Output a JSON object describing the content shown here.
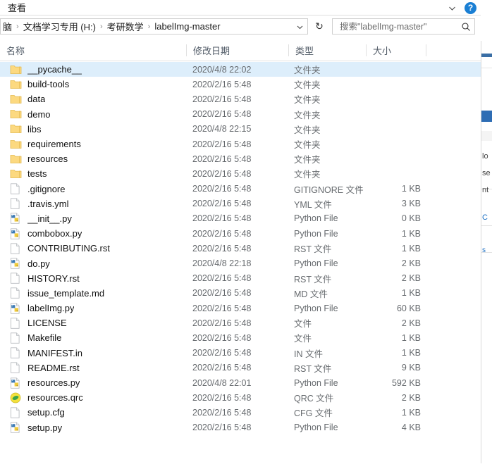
{
  "window": {
    "ribbon_tab": "查看",
    "collapse_icon": "chevron-down-icon",
    "help_icon": "help-question-icon",
    "help_label": "?"
  },
  "address_bar": {
    "breadcrumb": [
      {
        "label": "脑",
        "sep": "›"
      },
      {
        "label": "文档学习专用 (H:)",
        "sep": "›"
      },
      {
        "label": "考研数学",
        "sep": "›"
      },
      {
        "label": "labelImg-master",
        "sep": ""
      }
    ],
    "dropdown_icon": "chevron-down-icon",
    "refresh_icon": "refresh-icon",
    "refresh_label": "↻"
  },
  "search": {
    "placeholder": "搜索\"labelImg-master\"",
    "value": "",
    "icon": "search-icon"
  },
  "columns": {
    "name": "名称",
    "date": "修改日期",
    "type": "类型",
    "size": "大小",
    "last": "",
    "sort_icon": "sort-ascending-icon",
    "sorted_by": "名称"
  },
  "files": [
    {
      "name": "__pycache__",
      "date": "2020/4/8 22:02",
      "type": "文件夹",
      "size": "",
      "icon": "folder-icon",
      "selected": true
    },
    {
      "name": "build-tools",
      "date": "2020/2/16 5:48",
      "type": "文件夹",
      "size": "",
      "icon": "folder-icon",
      "selected": false
    },
    {
      "name": "data",
      "date": "2020/2/16 5:48",
      "type": "文件夹",
      "size": "",
      "icon": "folder-icon",
      "selected": false
    },
    {
      "name": "demo",
      "date": "2020/2/16 5:48",
      "type": "文件夹",
      "size": "",
      "icon": "folder-icon",
      "selected": false
    },
    {
      "name": "libs",
      "date": "2020/4/8 22:15",
      "type": "文件夹",
      "size": "",
      "icon": "folder-icon",
      "selected": false
    },
    {
      "name": "requirements",
      "date": "2020/2/16 5:48",
      "type": "文件夹",
      "size": "",
      "icon": "folder-icon",
      "selected": false
    },
    {
      "name": "resources",
      "date": "2020/2/16 5:48",
      "type": "文件夹",
      "size": "",
      "icon": "folder-icon",
      "selected": false
    },
    {
      "name": "tests",
      "date": "2020/2/16 5:48",
      "type": "文件夹",
      "size": "",
      "icon": "folder-icon",
      "selected": false
    },
    {
      "name": ".gitignore",
      "date": "2020/2/16 5:48",
      "type": "GITIGNORE 文件",
      "size": "1 KB",
      "icon": "generic-file-icon",
      "selected": false
    },
    {
      "name": ".travis.yml",
      "date": "2020/2/16 5:48",
      "type": "YML 文件",
      "size": "3 KB",
      "icon": "generic-file-icon",
      "selected": false
    },
    {
      "name": "__init__.py",
      "date": "2020/2/16 5:48",
      "type": "Python File",
      "size": "0 KB",
      "icon": "python-file-icon",
      "selected": false
    },
    {
      "name": "combobox.py",
      "date": "2020/2/16 5:48",
      "type": "Python File",
      "size": "1 KB",
      "icon": "python-file-icon",
      "selected": false
    },
    {
      "name": "CONTRIBUTING.rst",
      "date": "2020/2/16 5:48",
      "type": "RST 文件",
      "size": "1 KB",
      "icon": "generic-file-icon",
      "selected": false
    },
    {
      "name": "do.py",
      "date": "2020/4/8 22:18",
      "type": "Python File",
      "size": "2 KB",
      "icon": "python-file-icon",
      "selected": false
    },
    {
      "name": "HISTORY.rst",
      "date": "2020/2/16 5:48",
      "type": "RST 文件",
      "size": "2 KB",
      "icon": "generic-file-icon",
      "selected": false
    },
    {
      "name": "issue_template.md",
      "date": "2020/2/16 5:48",
      "type": "MD 文件",
      "size": "1 KB",
      "icon": "generic-file-icon",
      "selected": false
    },
    {
      "name": "labelImg.py",
      "date": "2020/2/16 5:48",
      "type": "Python File",
      "size": "60 KB",
      "icon": "python-file-icon",
      "selected": false
    },
    {
      "name": "LICENSE",
      "date": "2020/2/16 5:48",
      "type": "文件",
      "size": "2 KB",
      "icon": "generic-file-icon",
      "selected": false
    },
    {
      "name": "Makefile",
      "date": "2020/2/16 5:48",
      "type": "文件",
      "size": "1 KB",
      "icon": "generic-file-icon",
      "selected": false
    },
    {
      "name": "MANIFEST.in",
      "date": "2020/2/16 5:48",
      "type": "IN 文件",
      "size": "1 KB",
      "icon": "generic-file-icon",
      "selected": false
    },
    {
      "name": "README.rst",
      "date": "2020/2/16 5:48",
      "type": "RST 文件",
      "size": "9 KB",
      "icon": "generic-file-icon",
      "selected": false
    },
    {
      "name": "resources.py",
      "date": "2020/4/8 22:01",
      "type": "Python File",
      "size": "592 KB",
      "icon": "python-file-icon",
      "selected": false
    },
    {
      "name": "resources.qrc",
      "date": "2020/2/16 5:48",
      "type": "QRC 文件",
      "size": "2 KB",
      "icon": "qt-resource-icon",
      "selected": false
    },
    {
      "name": "setup.cfg",
      "date": "2020/2/16 5:48",
      "type": "CFG 文件",
      "size": "1 KB",
      "icon": "generic-file-icon",
      "selected": false
    },
    {
      "name": "setup.py",
      "date": "2020/2/16 5:48",
      "type": "Python File",
      "size": "4 KB",
      "icon": "python-file-icon",
      "selected": false
    }
  ],
  "background_window": {
    "fragments": [
      "lo",
      "se",
      "nt",
      "C",
      "s"
    ]
  },
  "colors": {
    "selection": "#ddeefb",
    "folder": "#fddc8b",
    "accent": "#1a7fd4",
    "header_text": "#505a66"
  }
}
